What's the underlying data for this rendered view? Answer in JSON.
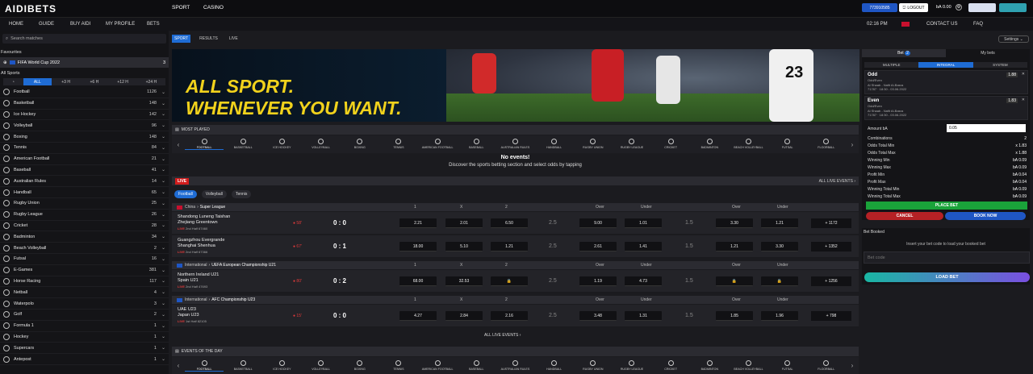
{
  "header": {
    "logo": "AIDIBETS",
    "nav": [
      "SPORT",
      "CASINO"
    ],
    "account_id": "773910585",
    "logout": "LOGOUT",
    "balance": "bA 0.00"
  },
  "nav2": {
    "items": [
      "HOME",
      "GUIDE",
      "BUY AIDI",
      "MY PROFILE",
      "BETS"
    ],
    "time": "02:16 PM",
    "right": [
      "CONTACT US",
      "FAQ"
    ]
  },
  "sidebar": {
    "search_placeholder": "Search matches",
    "favourites_title": "Favourites",
    "favourite": {
      "label": "FIFA World Cup 2022",
      "count": "3"
    },
    "all_sports_title": "All Sports",
    "time_filters": [
      "ALL",
      "+3 H",
      "+6 H",
      "+12 H",
      "+24 H"
    ],
    "sports": [
      {
        "name": "Football",
        "count": "1126"
      },
      {
        "name": "Basketball",
        "count": "148"
      },
      {
        "name": "Ice Hockey",
        "count": "142"
      },
      {
        "name": "Volleyball",
        "count": "96"
      },
      {
        "name": "Boxing",
        "count": "148"
      },
      {
        "name": "Tennis",
        "count": "84"
      },
      {
        "name": "American Football",
        "count": "21"
      },
      {
        "name": "Baseball",
        "count": "41"
      },
      {
        "name": "Australian Rules",
        "count": "14"
      },
      {
        "name": "Handball",
        "count": "65"
      },
      {
        "name": "Rugby Union",
        "count": "25"
      },
      {
        "name": "Rugby League",
        "count": "26"
      },
      {
        "name": "Cricket",
        "count": "28"
      },
      {
        "name": "Badminton",
        "count": "34"
      },
      {
        "name": "Beach Volleyball",
        "count": "2"
      },
      {
        "name": "Futsal",
        "count": "16"
      },
      {
        "name": "E-Games",
        "count": "381"
      },
      {
        "name": "Horse Racing",
        "count": "117"
      },
      {
        "name": "Netball",
        "count": "4"
      },
      {
        "name": "Waterpolo",
        "count": "3"
      },
      {
        "name": "Golf",
        "count": "2"
      },
      {
        "name": "Formula 1",
        "count": "1"
      },
      {
        "name": "Hockey",
        "count": "1"
      },
      {
        "name": "Supercars",
        "count": "1"
      },
      {
        "name": "Antepost",
        "count": "1"
      }
    ]
  },
  "subtabs": [
    "SPORT",
    "RESULTS",
    "LIVE"
  ],
  "settings": "Settings",
  "banner": {
    "line1": "ALL SPORT.",
    "line2": "WHENEVER YOU WANT.",
    "jersey": "23"
  },
  "most_played": "MOST PLAYED",
  "events_of_day": "EVENTS OF THE DAY",
  "sport_icons": [
    "FOOTBALL",
    "BASKETBALL",
    "ICE HOCKEY",
    "VOLLEYBALL",
    "BOXING",
    "TENNIS",
    "AMERICAN FOOTBALL",
    "BASEBALL",
    "AUSTRALIAN RULES",
    "HANDBALL",
    "RUGBY UNION",
    "RUGBY LEAGUE",
    "CRICKET",
    "BADMINTON",
    "BEACH VOLLEYBALL",
    "FUTSAL",
    "FLOORBALL"
  ],
  "no_events": {
    "title": "No events!",
    "subtitle": "Discover the sports betting section and select odds by tapping"
  },
  "live": {
    "label": "LIVE",
    "all_link": "ALL LIVE EVENTS",
    "tabs": [
      "Football",
      "Volleyball",
      "Tennis"
    ],
    "col_headers": [
      "1",
      "X",
      "2",
      "Over",
      "Under",
      "Over",
      "Under"
    ],
    "leagues": [
      {
        "country": "China",
        "name": "Super League",
        "matches": [
          {
            "home": "Shandong Luneng Taishan",
            "away": "Zhejiang Greentown",
            "live": "LIVE",
            "period": "2nd Half",
            "id": "67460",
            "minute": "58'",
            "score": "0 : 0",
            "odds": [
              "2.21",
              "2.01",
              "6.50"
            ],
            "line1": "2.5",
            "ou1": [
              "9.00",
              "1.01"
            ],
            "line2": "1.5",
            "ou2": [
              "3.30",
              "1.21"
            ],
            "more": "+ 1172"
          },
          {
            "home": "Guangzhou Evergrande",
            "away": "Shanghai Shenhua",
            "live": "LIVE",
            "period": "2nd Half",
            "id": "67366",
            "minute": "67'",
            "score": "0 : 1",
            "odds": [
              "18.00",
              "5.10",
              "1.21"
            ],
            "line1": "2.5",
            "ou1": [
              "2.61",
              "1.41"
            ],
            "line2": "1.5",
            "ou2": [
              "1.21",
              "3.30"
            ],
            "more": "+ 1352"
          }
        ]
      },
      {
        "country": "International",
        "name": "UEFA European Championship U21",
        "matches": [
          {
            "home": "Northern Ireland U21",
            "away": "Spain U21",
            "live": "LIVE",
            "period": "2nd Half",
            "id": "47693",
            "minute": "80'",
            "score": "0 : 2",
            "odds": [
              "68.00",
              "32.53",
              ""
            ],
            "line1": "2.5",
            "ou1": [
              "1.19",
              "4.73"
            ],
            "line2": "1.5",
            "ou2": [
              "",
              ""
            ],
            "more": "+ 1256"
          }
        ]
      },
      {
        "country": "International",
        "name": "AFC Championship U23",
        "matches": [
          {
            "home": "UAE U23",
            "away": "Japan U23",
            "live": "LIVE",
            "period": "1st Half",
            "id": "82105",
            "minute": "15'",
            "score": "0 : 0",
            "odds": [
              "4.27",
              "2.84",
              "2.16"
            ],
            "line1": "2.5",
            "ou1": [
              "3.48",
              "1.31"
            ],
            "line2": "1.5",
            "ou2": [
              "1.85",
              "1.96"
            ],
            "more": "+ 798"
          }
        ]
      }
    ],
    "all_bottom": "ALL LIVE EVENTS"
  },
  "betslip": {
    "tabs": [
      "Bet",
      "My bets"
    ],
    "bet_count": "2",
    "modes": [
      "MULTIPLE",
      "INTEGRAL",
      "SYSTEM"
    ],
    "selections": [
      {
        "name": "Odd",
        "market": "Odd/Even",
        "match": "Al Shaab - Nafit Al-Basra",
        "info": "71787 · 18:30 - 03.06.2022",
        "odd": "1.88"
      },
      {
        "name": "Even",
        "market": "Odd/Even",
        "match": "Al Shaab - Nafit Al-Basra",
        "info": "71787 · 18:30 - 03.06.2022",
        "odd": "1.83"
      }
    ],
    "amount_label": "Amount bA",
    "amount": "0.05",
    "summary": [
      {
        "label": "Combinations",
        "value": "2"
      },
      {
        "label": "Odds Total Min",
        "value": "x 1.83"
      },
      {
        "label": "Odds Total Max",
        "value": "x 1.88"
      },
      {
        "label": "Winning Min",
        "value": "bA 0.09"
      },
      {
        "label": "Winning Max",
        "value": "bA 0.09"
      },
      {
        "label": "Profit Min",
        "value": "bA 0.04"
      },
      {
        "label": "Profit Max",
        "value": "bA 0.04"
      },
      {
        "label": "Winning Total Min",
        "value": "bA 0.09"
      },
      {
        "label": "Winning Total Max",
        "value": "bA 0.09"
      }
    ],
    "place_bet": "PLACE BET",
    "cancel": "CANCEL",
    "book_now": "BOOK NOW"
  },
  "booked": {
    "title": "Bet Booked",
    "hint": "Insert your bet code to load your booked bet",
    "placeholder": "Bet code",
    "load": "LOAD BET"
  },
  "colors": {
    "accent": "#1f6cd4",
    "live": "#d21d1d",
    "place": "#1aa33a",
    "banner_text": "#f1d21c"
  }
}
